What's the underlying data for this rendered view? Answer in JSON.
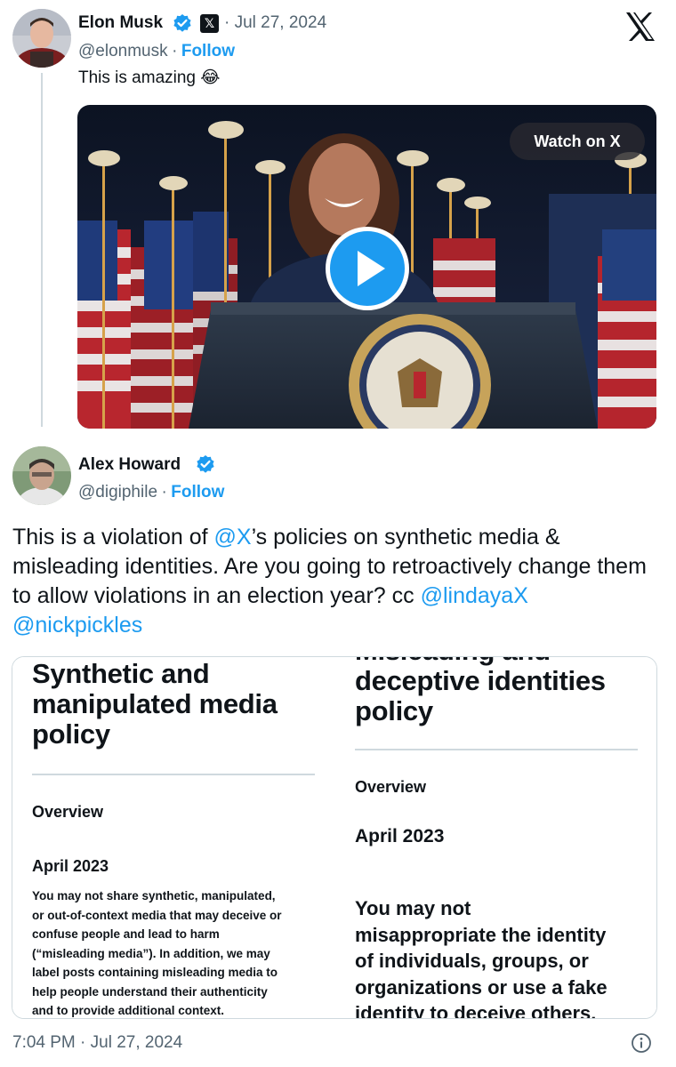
{
  "quoted_post": {
    "author_name": "Elon Musk",
    "x_badge": "𝕏",
    "date": "· Jul 27, 2024",
    "handle": "@elonmusk",
    "separator": "·",
    "follow_label": "Follow",
    "text": "This is amazing 😂",
    "video": {
      "watch_label": "Watch on X"
    }
  },
  "post": {
    "author_name": "Alex Howard",
    "handle": "@digiphile",
    "separator": "·",
    "follow_label": "Follow",
    "text_parts": {
      "p1": "This is a violation of ",
      "m1": "@X",
      "p2": "’s policies on synthetic media & misleading identities. Are you going to retroactively change them to allow violations in an election year? cc ",
      "m2": "@lindayaX",
      "p3": " ",
      "m3": "@nickpickles"
    },
    "timestamp": "7:04 PM · Jul 27, 2024"
  },
  "policy_screenshot": {
    "left": {
      "title_lines": [
        "Synthetic and",
        "manipulated media",
        "policy"
      ],
      "section": "Overview",
      "date": "April 2023",
      "body_lines": [
        "You may not share synthetic, manipulated,",
        "or out-of-context media that may deceive or",
        "confuse people and lead to harm",
        "(“misleading media”). In addition, we may",
        "label posts containing misleading media to",
        "help people understand their authenticity",
        "and to provide additional context."
      ]
    },
    "right": {
      "title_lines": [
        "Misleading and",
        "deceptive identities",
        "policy"
      ],
      "section": "Overview",
      "date": "April 2023",
      "body_lines": [
        "You may not",
        "misappropriate the identity",
        "of individuals, groups, or",
        "organizations or use a fake",
        "identity to deceive others."
      ]
    }
  },
  "colors": {
    "accent": "#1d9bf0",
    "text": "#0f1419",
    "muted": "#536471",
    "border": "#cfd9de"
  }
}
